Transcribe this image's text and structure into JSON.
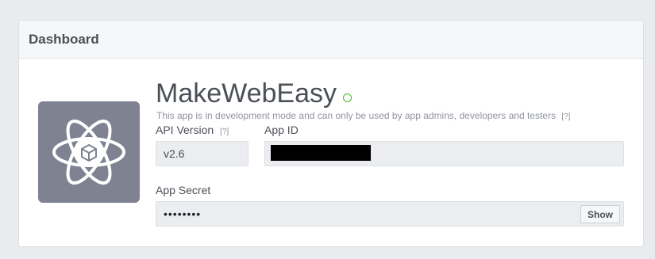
{
  "header": {
    "title": "Dashboard"
  },
  "app": {
    "name": "MakeWebEasy",
    "status_note": "This app is in development mode and can only be used by app admins, developers and testers",
    "help_marker": "[?]",
    "icon": "atom-cube-icon",
    "status_color": "#42b72a"
  },
  "api_version": {
    "label": "API Version",
    "help": "[?]",
    "value": "v2.6"
  },
  "app_id": {
    "label": "App ID",
    "value_redacted": true
  },
  "app_secret": {
    "label": "App Secret",
    "value": "••••••••",
    "show_label": "Show"
  }
}
